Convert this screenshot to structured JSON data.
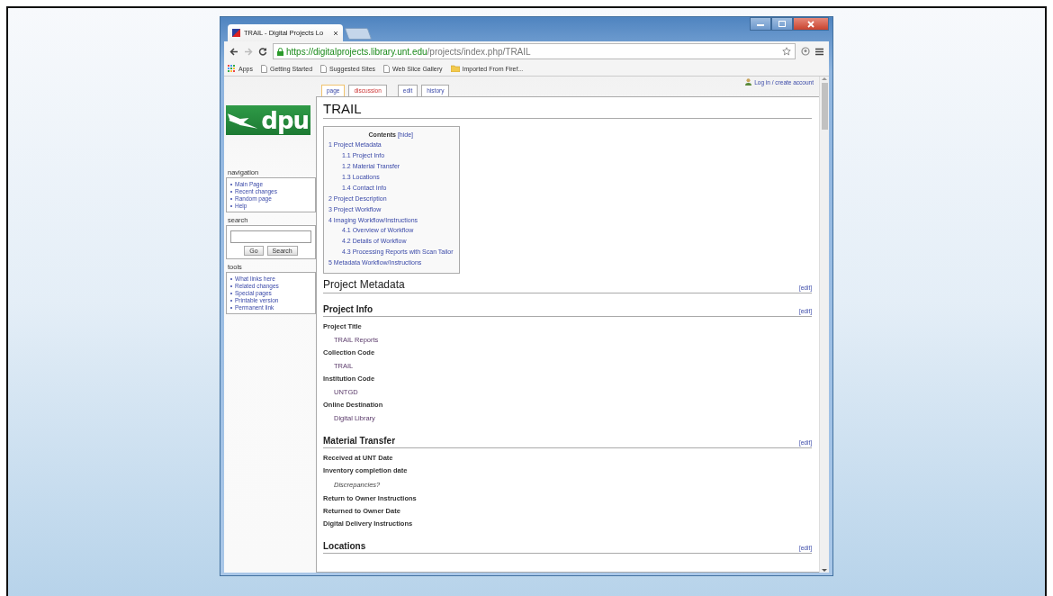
{
  "browser": {
    "tab_title": "TRAIL - Digital Projects Lo",
    "url_host": "https://digitalprojects.library.unt.edu",
    "url_path": "/projects/index.php/TRAIL",
    "bookmarks": [
      {
        "label": "Apps",
        "kind": "apps"
      },
      {
        "label": "Getting Started",
        "kind": "page"
      },
      {
        "label": "Suggested Sites",
        "kind": "page"
      },
      {
        "label": "Web Slice Gallery",
        "kind": "page"
      },
      {
        "label": "Imported From Firef...",
        "kind": "folder"
      }
    ]
  },
  "user_link": "Log in / create account",
  "logo": {
    "text": "dpu"
  },
  "page_tabs": [
    {
      "label": "page",
      "selected": true,
      "exists": true
    },
    {
      "label": "discussion",
      "selected": false,
      "exists": false
    },
    {
      "label": "edit",
      "selected": false,
      "exists": true
    },
    {
      "label": "history",
      "selected": false,
      "exists": true
    }
  ],
  "sidebar": {
    "navigation": {
      "title": "navigation",
      "items": [
        "Main Page",
        "Recent changes",
        "Random page",
        "Help"
      ]
    },
    "search": {
      "title": "search",
      "buttons": [
        "Go",
        "Search"
      ]
    },
    "tools": {
      "title": "tools",
      "items": [
        "What links here",
        "Related changes",
        "Special pages",
        "Printable version",
        "Permanent link"
      ]
    }
  },
  "content": {
    "title": "TRAIL",
    "toc": {
      "title": "Contents",
      "toggle": "[hide]",
      "entries": [
        {
          "text": "1 Project Metadata",
          "children": [
            {
              "text": "1.1 Project Info"
            },
            {
              "text": "1.2 Material Transfer"
            },
            {
              "text": "1.3 Locations"
            },
            {
              "text": "1.4 Contact Info"
            }
          ]
        },
        {
          "text": "2 Project Description"
        },
        {
          "text": "3 Project Workflow"
        },
        {
          "text": "4 Imaging Workflow/Instructions",
          "children": [
            {
              "text": "4.1 Overview of Workflow"
            },
            {
              "text": "4.2 Details of Workflow"
            },
            {
              "text": "4.3 Processing Reports with Scan Tailor"
            }
          ]
        },
        {
          "text": "5 Metadata Workflow/Instructions"
        }
      ]
    },
    "sections": [
      {
        "kind": "h2",
        "heading": "Project Metadata",
        "edit": "[edit]"
      },
      {
        "kind": "h3",
        "heading": "Project Info",
        "edit": "[edit]",
        "lines": [
          {
            "kind": "label",
            "text": "Project Title"
          },
          {
            "kind": "value",
            "text": "TRAIL Reports"
          },
          {
            "kind": "label",
            "text": "Collection Code"
          },
          {
            "kind": "value",
            "text": "TRAIL"
          },
          {
            "kind": "label",
            "text": "Institution Code"
          },
          {
            "kind": "value",
            "text": "UNTGD"
          },
          {
            "kind": "label",
            "text": "Online Destination"
          },
          {
            "kind": "value",
            "text": "Digital Library"
          }
        ]
      },
      {
        "kind": "h3",
        "heading": "Material Transfer",
        "edit": "[edit]",
        "lines": [
          {
            "kind": "label",
            "text": "Received at UNT Date"
          },
          {
            "kind": "label",
            "text": "Inventory completion date"
          },
          {
            "kind": "note",
            "text": "Discrepancies?"
          },
          {
            "kind": "label",
            "text": "Return to Owner Instructions"
          },
          {
            "kind": "label",
            "text": "Returned to Owner Date"
          },
          {
            "kind": "label",
            "text": "Digital Delivery Instructions"
          }
        ]
      },
      {
        "kind": "h3",
        "heading": "Locations",
        "edit": "[edit]"
      }
    ]
  }
}
